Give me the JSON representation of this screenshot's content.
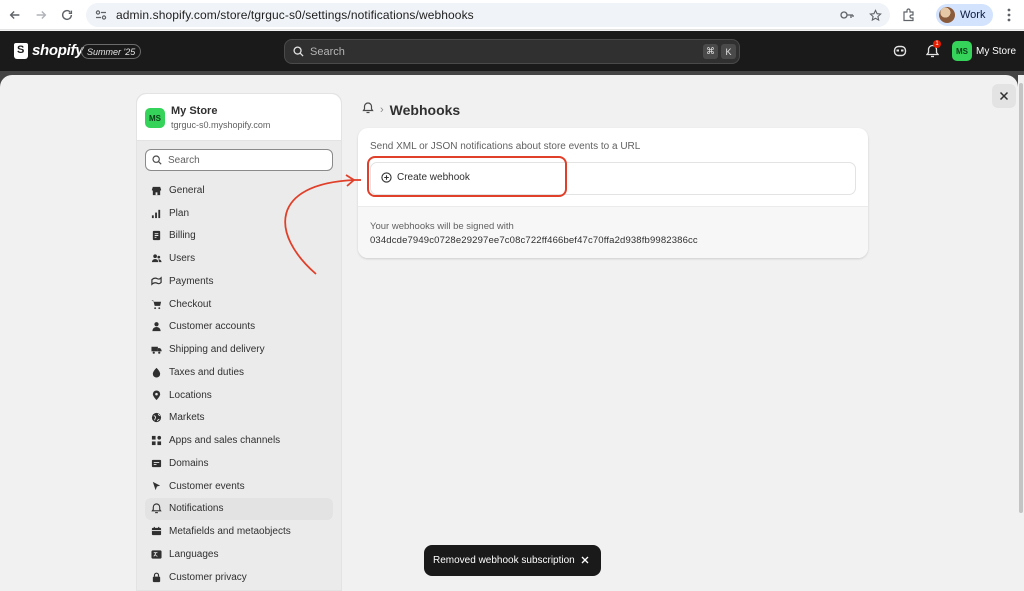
{
  "browser": {
    "url": "admin.shopify.com/store/tgrguc-s0/settings/notifications/webhooks",
    "profile_label": "Work"
  },
  "topbar": {
    "brand": "shopify",
    "edition": "Summer '25",
    "search_placeholder": "Search",
    "shortcut_keys": [
      "⌘",
      "K"
    ],
    "notification_count": "1",
    "store_initials": "MS",
    "store_name": "My Store"
  },
  "sidebar": {
    "store_initials": "MS",
    "store_name": "My Store",
    "store_domain": "tgrguc-s0.myshopify.com",
    "search_placeholder": "Search",
    "items": [
      {
        "label": "General",
        "icon": "store-icon"
      },
      {
        "label": "Plan",
        "icon": "plan-icon"
      },
      {
        "label": "Billing",
        "icon": "billing-icon"
      },
      {
        "label": "Users",
        "icon": "users-icon"
      },
      {
        "label": "Payments",
        "icon": "payments-icon"
      },
      {
        "label": "Checkout",
        "icon": "cart-icon"
      },
      {
        "label": "Customer accounts",
        "icon": "person-icon"
      },
      {
        "label": "Shipping and delivery",
        "icon": "truck-icon"
      },
      {
        "label": "Taxes and duties",
        "icon": "taxes-icon"
      },
      {
        "label": "Locations",
        "icon": "location-icon"
      },
      {
        "label": "Markets",
        "icon": "globe-icon"
      },
      {
        "label": "Apps and sales channels",
        "icon": "apps-icon"
      },
      {
        "label": "Domains",
        "icon": "domain-icon"
      },
      {
        "label": "Customer events",
        "icon": "cursor-icon"
      },
      {
        "label": "Notifications",
        "icon": "bell-icon",
        "active": true
      },
      {
        "label": "Metafields and metaobjects",
        "icon": "metafields-icon"
      },
      {
        "label": "Languages",
        "icon": "language-icon"
      },
      {
        "label": "Customer privacy",
        "icon": "lock-icon"
      }
    ]
  },
  "main": {
    "page_title": "Webhooks",
    "description": "Send XML or JSON notifications about store events to a URL",
    "create_label": "Create webhook",
    "signed_label": "Your webhooks will be signed with",
    "signing_key": "034dcde7949c0728e29297ee7c08c722ff466bef47c70ffa2d938fb9982386cc"
  },
  "toast": {
    "message": "Removed webhook subscription"
  },
  "colors": {
    "annotation": "#e0402a",
    "brand_green": "#35d35a",
    "topbar": "#1a1a1a"
  }
}
